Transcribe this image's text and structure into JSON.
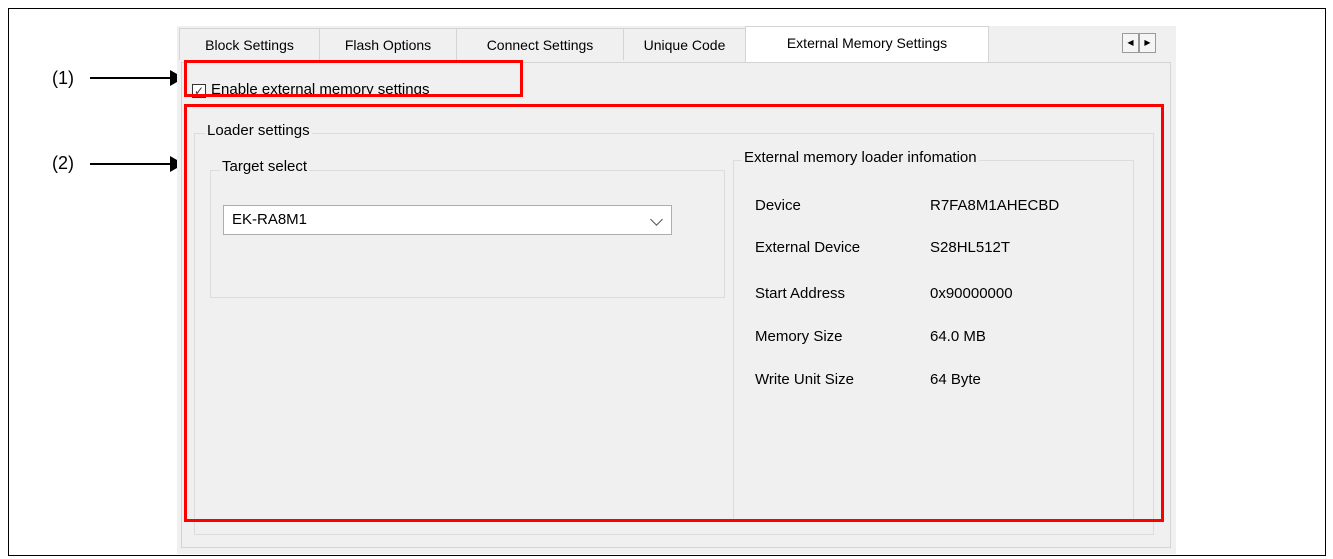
{
  "tabs": [
    {
      "label": "Block Settings"
    },
    {
      "label": "Flash Options"
    },
    {
      "label": "Connect Settings"
    },
    {
      "label": "Unique Code"
    },
    {
      "label": "External Memory Settings",
      "active": true
    }
  ],
  "tab_scroll": {
    "left_icon": "triangle-left-icon",
    "right_icon": "triangle-right-icon",
    "left": "◀",
    "right": "▶"
  },
  "enable_checkbox": {
    "label": "Enable external memory settings",
    "checked": true,
    "mark": "✓"
  },
  "loader_settings": {
    "title": "Loader settings",
    "target_select": {
      "title": "Target select",
      "value": "EK-RA8M1"
    },
    "info": {
      "title": "External memory loader infomation",
      "rows": [
        {
          "label": "Device",
          "value": "R7FA8M1AHECBD"
        },
        {
          "label": "External Device",
          "value": "S28HL512T"
        },
        {
          "label": "Start Address",
          "value": "0x90000000"
        },
        {
          "label": "Memory Size",
          "value": "64.0 MB"
        },
        {
          "label": "Write Unit Size",
          "value": "64 Byte"
        }
      ]
    }
  },
  "callouts": [
    {
      "label": "(1)"
    },
    {
      "label": "(2)"
    }
  ],
  "colors": {
    "highlight": "#ff0000",
    "dialog_bg": "#f0f0f0"
  }
}
